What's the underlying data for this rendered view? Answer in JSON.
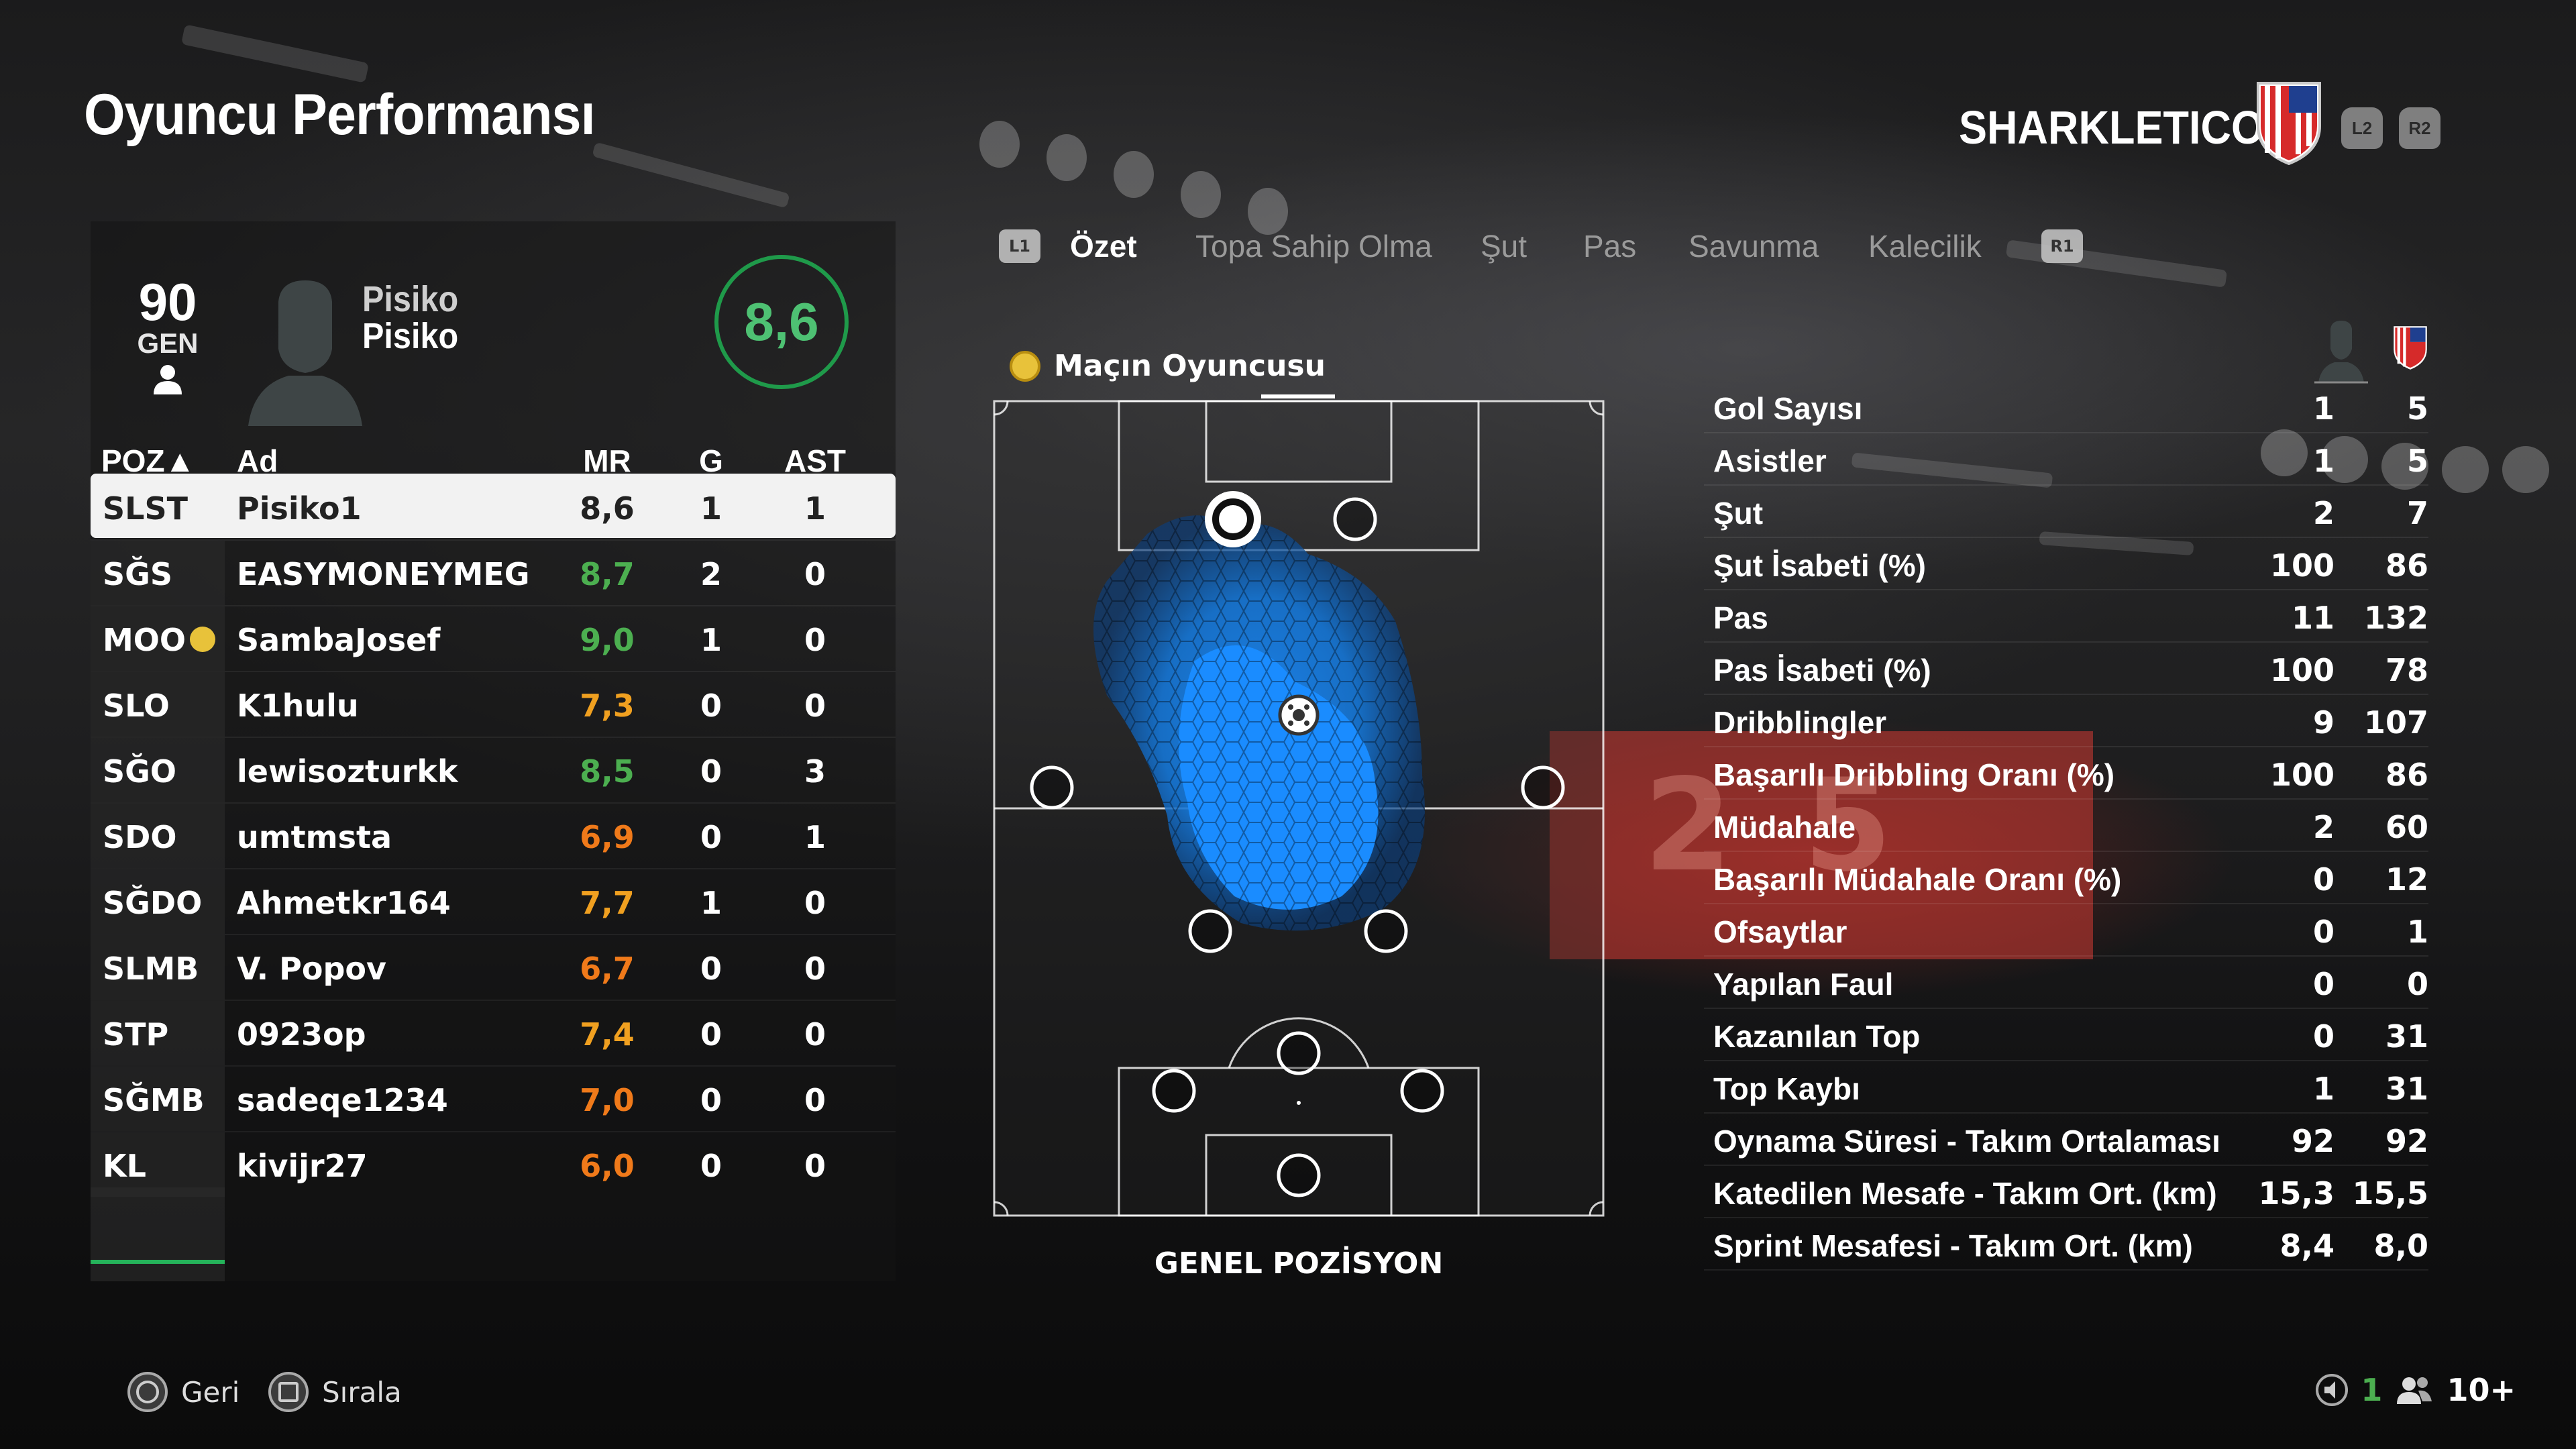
{
  "title": "Oyuncu Performansı",
  "team": {
    "name": "SHARKLETICO",
    "prev_button": "L2",
    "next_button": "R2"
  },
  "player": {
    "overall": "90",
    "overall_label": "GEN",
    "first_name": "Pisiko",
    "last_name": "Pisiko",
    "match_rating": "8,6"
  },
  "table": {
    "headers": {
      "pos": "POZ▲",
      "name": "Ad",
      "mr": "MR",
      "g": "G",
      "ast": "AST"
    },
    "rows": [
      {
        "pos": "SLST",
        "name": "Pisiko1",
        "mr": "8,6",
        "mr_color": "#222222",
        "g": "1",
        "ast": "1",
        "selected": true
      },
      {
        "pos": "SĞS",
        "name": "EASYMONEYMEG",
        "mr": "8,7",
        "mr_color": "#4caf50",
        "g": "2",
        "ast": "0"
      },
      {
        "pos": "MOO",
        "name": "SambaJosef",
        "mr": "9,0",
        "mr_color": "#4caf50",
        "g": "1",
        "ast": "0",
        "motm": true
      },
      {
        "pos": "SLO",
        "name": "K1hulu",
        "mr": "7,3",
        "mr_color": "#f0a020",
        "g": "0",
        "ast": "0"
      },
      {
        "pos": "SĞO",
        "name": "lewisozturkk",
        "mr": "8,5",
        "mr_color": "#4caf50",
        "g": "0",
        "ast": "3"
      },
      {
        "pos": "SDO",
        "name": "umtmsta",
        "mr": "6,9",
        "mr_color": "#f07a1a",
        "g": "0",
        "ast": "1"
      },
      {
        "pos": "SĞDO",
        "name": "Ahmetkr164",
        "mr": "7,7",
        "mr_color": "#f0a020",
        "g": "1",
        "ast": "0"
      },
      {
        "pos": "SLMB",
        "name": "V. Popov",
        "mr": "6,7",
        "mr_color": "#f07a1a",
        "g": "0",
        "ast": "0"
      },
      {
        "pos": "STP",
        "name": "0923op",
        "mr": "7,4",
        "mr_color": "#f0a020",
        "g": "0",
        "ast": "0"
      },
      {
        "pos": "SĞMB",
        "name": "sadeqe1234",
        "mr": "7,0",
        "mr_color": "#f07a1a",
        "g": "0",
        "ast": "0"
      },
      {
        "pos": "KL",
        "name": "kivijr27",
        "mr": "6,0",
        "mr_color": "#f07a1a",
        "g": "0",
        "ast": "0"
      }
    ]
  },
  "tabs": {
    "left_button": "L1",
    "right_button": "R1",
    "items": [
      "Özet",
      "Topa Sahip Olma",
      "Şut",
      "Pas",
      "Savunma",
      "Kalecilik"
    ],
    "active_index": 0
  },
  "pitch": {
    "motm_label": "Maçın Oyuncusu",
    "caption": "GENEL POZİSYON"
  },
  "stats": [
    {
      "label": "Gol Sayısı",
      "player": "1",
      "team": "5"
    },
    {
      "label": "Asistler",
      "player": "1",
      "team": "5"
    },
    {
      "label": "Şut",
      "player": "2",
      "team": "7"
    },
    {
      "label": "Şut İsabeti (%)",
      "player": "100",
      "team": "86"
    },
    {
      "label": "Pas",
      "player": "11",
      "team": "132"
    },
    {
      "label": "Pas İsabeti (%)",
      "player": "100",
      "team": "78"
    },
    {
      "label": "Dribblingler",
      "player": "9",
      "team": "107"
    },
    {
      "label": "Başarılı Dribbling Oranı (%)",
      "player": "100",
      "team": "86"
    },
    {
      "label": "Müdahale",
      "player": "2",
      "team": "60"
    },
    {
      "label": "Başarılı Müdahale Oranı (%)",
      "player": "0",
      "team": "12"
    },
    {
      "label": "Ofsaytlar",
      "player": "0",
      "team": "1"
    },
    {
      "label": "Yapılan Faul",
      "player": "0",
      "team": "0"
    },
    {
      "label": "Kazanılan Top",
      "player": "0",
      "team": "31"
    },
    {
      "label": "Top Kaybı",
      "player": "1",
      "team": "31"
    },
    {
      "label": "Oynama Süresi - Takım Ortalaması",
      "player": "92",
      "team": "92"
    },
    {
      "label": "Katedilen Mesafe - Takım Ort. (km)",
      "player": "15,3",
      "team": "15,5"
    },
    {
      "label": "Sprint Mesafesi - Takım Ort. (km)",
      "player": "8,4",
      "team": "8,0"
    }
  ],
  "footer": {
    "back_label": "Geri",
    "sort_label": "Sırala",
    "voice_count": "1",
    "party_count": "10+"
  },
  "colors": {
    "accent_green": "#25b35a",
    "rating_green": "#4caf50",
    "rating_amber": "#f0a020",
    "rating_orange": "#f07a1a",
    "heatmap_blue": "#1a8cff"
  }
}
